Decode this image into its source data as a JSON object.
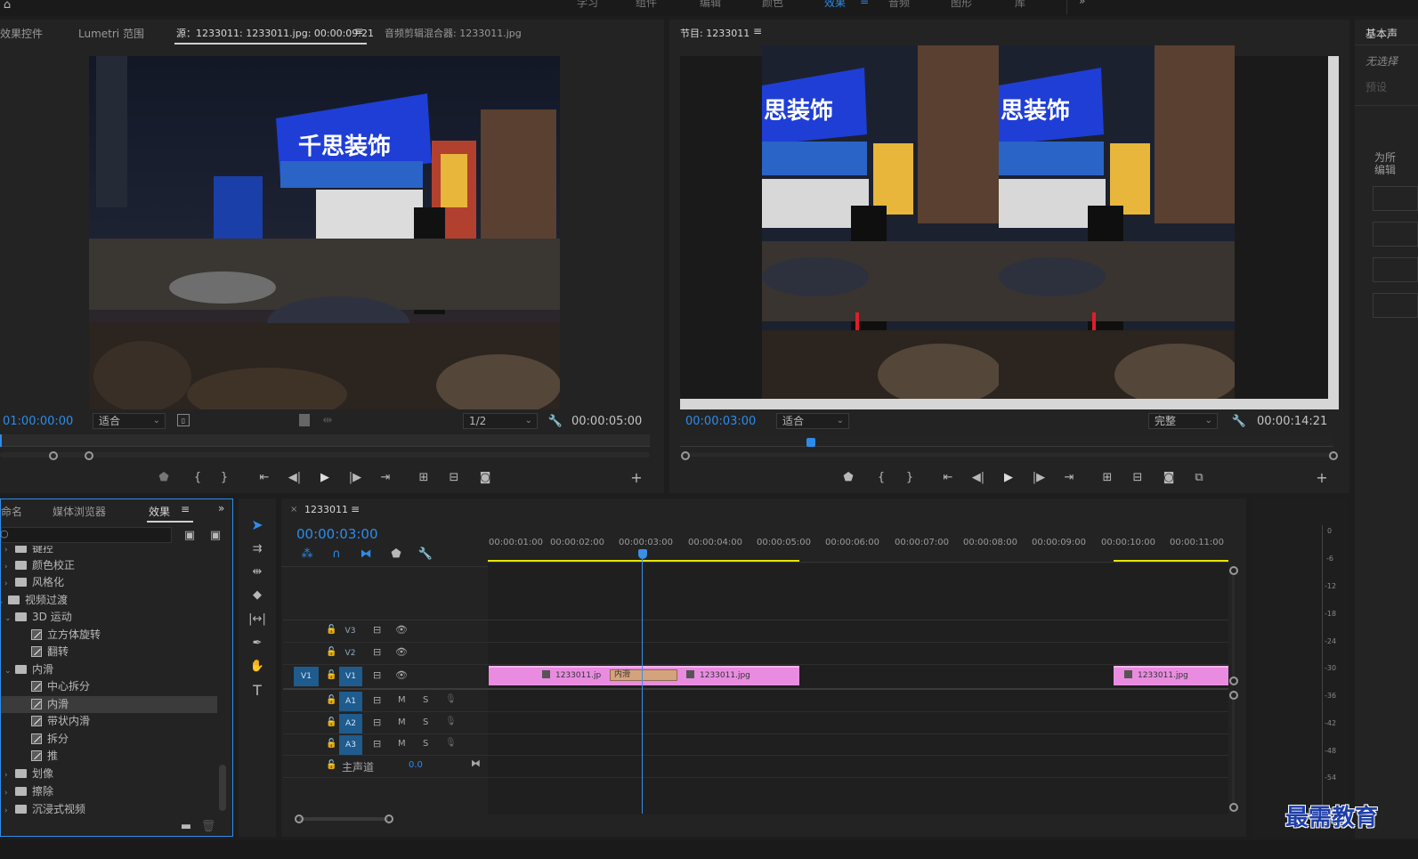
{
  "top_menu": {
    "items": [
      "学习",
      "组件",
      "编辑",
      "颜色",
      "效果",
      "音频",
      "图形",
      "库"
    ],
    "more": "»"
  },
  "source_panel": {
    "tabs": {
      "effect_controls": "效果控件",
      "lumetri": "Lumetri 范围",
      "source": "源：1233011: 1233011.jpg: 00:00:09:21",
      "audio_mixer": "音频剪辑混合器: 1233011.jpg"
    },
    "timecode_left": "01:00:00:00",
    "fit": "适合",
    "resolution": "1/2",
    "timecode_right": "00:00:05:00"
  },
  "program_panel": {
    "tab": "节目: 1233011",
    "timecode_left": "00:00:03:00",
    "fit": "适合",
    "quality": "完整",
    "timecode_right": "00:00:14:21"
  },
  "right_panel": {
    "title": "基本声",
    "line1": "无选择",
    "line2": "预设",
    "line3": "为所",
    "line4": "编辑"
  },
  "project_panel": {
    "tabs": {
      "name": "命名",
      "media_browser": "媒体浏览器",
      "effects": "效果"
    },
    "tree": [
      {
        "label": "键控",
        "type": "folder",
        "level": 1
      },
      {
        "label": "颜色校正",
        "type": "folder",
        "level": 1
      },
      {
        "label": "风格化",
        "type": "folder",
        "level": 1
      },
      {
        "label": "视频过渡",
        "type": "folder",
        "level": 0
      },
      {
        "label": "3D 运动",
        "type": "folder",
        "level": 1
      },
      {
        "label": "立方体旋转",
        "type": "preset",
        "level": 2
      },
      {
        "label": "翻转",
        "type": "preset",
        "level": 2
      },
      {
        "label": "内滑",
        "type": "folder",
        "level": 1
      },
      {
        "label": "中心拆分",
        "type": "preset",
        "level": 2
      },
      {
        "label": "内滑",
        "type": "preset",
        "level": 2,
        "selected": true
      },
      {
        "label": "带状内滑",
        "type": "preset",
        "level": 2
      },
      {
        "label": "拆分",
        "type": "preset",
        "level": 2
      },
      {
        "label": "推",
        "type": "preset",
        "level": 2
      },
      {
        "label": "划像",
        "type": "folder",
        "level": 1
      },
      {
        "label": "擦除",
        "type": "folder",
        "level": 1
      },
      {
        "label": "沉浸式视频",
        "type": "folder",
        "level": 1
      }
    ]
  },
  "timeline": {
    "sequence_tab": "1233011",
    "timecode": "00:00:03:00",
    "ruler_labels": [
      "00:00:01:00",
      "00:00:02:00",
      "00:00:03:00",
      "00:00:04:00",
      "00:00:05:00",
      "00:00:06:00",
      "00:00:07:00",
      "00:00:08:00",
      "00:00:09:00",
      "00:00:10:00",
      "00:00:11:00"
    ],
    "tracks": {
      "v3": "V3",
      "v2": "V2",
      "v1": "V1",
      "v1_src": "V1",
      "a1": "A1",
      "a2": "A2",
      "a3": "A3",
      "mute": "M",
      "solo": "S",
      "master": "主声道",
      "master_value": "0.0"
    },
    "clips": {
      "clip1": "1233011.jp",
      "transition": "内滑",
      "clip2": "1233011.jpg",
      "clip3": "1233011.jpg"
    }
  },
  "audio_meter": {
    "labels": [
      "0",
      "-6",
      "-12",
      "-18",
      "-24",
      "-30",
      "-36",
      "-42",
      "-48",
      "-54"
    ]
  },
  "watermark": "最需教育",
  "colors": {
    "accent_blue": "#2d8ceb",
    "clip_pink": "#e98ce0",
    "transition_tan": "#d4a37c",
    "workarea_yellow": "#e6e600",
    "playhead": "#3b8fe6"
  }
}
